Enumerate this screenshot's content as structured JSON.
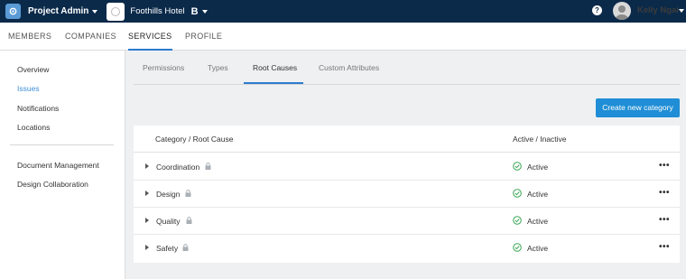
{
  "topbar": {
    "app_title": "Project Admin",
    "project_name": "Foothills Hotel",
    "project_badge": "B",
    "help_label": "?",
    "user_name": "Kelly Ngai"
  },
  "nav": {
    "tabs": [
      {
        "label": "MEMBERS"
      },
      {
        "label": "COMPANIES"
      },
      {
        "label": "SERVICES"
      },
      {
        "label": "PROFILE"
      }
    ],
    "active": "SERVICES"
  },
  "sidebar": {
    "items": [
      {
        "label": "Overview"
      },
      {
        "label": "Issues"
      },
      {
        "label": "Notifications"
      },
      {
        "label": "Locations"
      },
      {
        "label": "Document Management"
      },
      {
        "label": "Design Collaboration"
      }
    ],
    "active": "Issues"
  },
  "subtabs": {
    "items": [
      {
        "label": "Permissions"
      },
      {
        "label": "Types"
      },
      {
        "label": "Root Causes"
      },
      {
        "label": "Custom Attributes"
      }
    ],
    "active": "Root Causes"
  },
  "actions": {
    "create_label": "Create new category"
  },
  "table": {
    "columns": [
      "Category / Root Cause",
      "Active / Inactive"
    ],
    "rows": [
      {
        "name": "Coordination",
        "status": "Active"
      },
      {
        "name": "Design",
        "status": "Active"
      },
      {
        "name": "Quality",
        "status": "Active"
      },
      {
        "name": "Safety",
        "status": "Active"
      }
    ],
    "more_label": "•••"
  },
  "colors": {
    "topbar": "#0b2a4a",
    "accent": "#2b7bd0",
    "button": "#1f8ed6",
    "active_green": "#3aa655"
  }
}
